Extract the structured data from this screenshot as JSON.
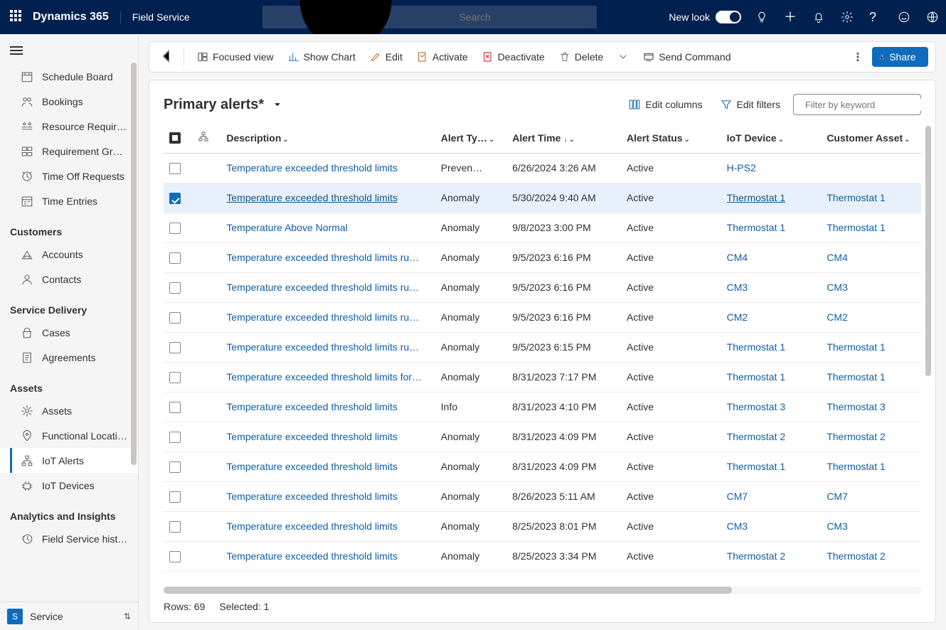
{
  "top": {
    "brand": "Dynamics 365",
    "app": "Field Service",
    "search_placeholder": "Search",
    "new_look": "New look"
  },
  "nav": {
    "groups": [
      {
        "title": null,
        "items": [
          {
            "id": "schedule-board",
            "label": "Schedule Board"
          },
          {
            "id": "bookings",
            "label": "Bookings"
          },
          {
            "id": "resource-req",
            "label": "Resource Require…"
          },
          {
            "id": "req-groups",
            "label": "Requirement Gro…"
          },
          {
            "id": "time-off",
            "label": "Time Off Requests"
          },
          {
            "id": "time-entries",
            "label": "Time Entries"
          }
        ]
      },
      {
        "title": "Customers",
        "items": [
          {
            "id": "accounts",
            "label": "Accounts"
          },
          {
            "id": "contacts",
            "label": "Contacts"
          }
        ]
      },
      {
        "title": "Service Delivery",
        "items": [
          {
            "id": "cases",
            "label": "Cases"
          },
          {
            "id": "agreements",
            "label": "Agreements"
          }
        ]
      },
      {
        "title": "Assets",
        "items": [
          {
            "id": "assets",
            "label": "Assets"
          },
          {
            "id": "func-loc",
            "label": "Functional Locati…"
          },
          {
            "id": "iot-alerts",
            "label": "IoT Alerts",
            "selected": true
          },
          {
            "id": "iot-devices",
            "label": "IoT Devices"
          }
        ]
      },
      {
        "title": "Analytics and Insights",
        "items": [
          {
            "id": "fs-history",
            "label": "Field Service histo…"
          }
        ]
      }
    ],
    "area_badge": "S",
    "area_label": "Service"
  },
  "commands": {
    "focused_view": "Focused view",
    "show_chart": "Show Chart",
    "edit": "Edit",
    "activate": "Activate",
    "deactivate": "Deactivate",
    "delete": "Delete",
    "send_command": "Send Command",
    "share": "Share"
  },
  "view": {
    "title": "Primary alerts*",
    "edit_columns": "Edit columns",
    "edit_filters": "Edit filters",
    "filter_placeholder": "Filter by keyword"
  },
  "columns": {
    "description": "Description",
    "alert_type": "Alert Ty…",
    "alert_time": "Alert Time",
    "alert_status": "Alert Status",
    "iot_device": "IoT Device",
    "customer_asset": "Customer Asset"
  },
  "rows": [
    {
      "desc": "Temperature exceeded threshold limits",
      "type": "Preven…",
      "time": "6/26/2024 3:26 AM",
      "status": "Active",
      "device": "H-PS2",
      "asset": ""
    },
    {
      "desc": "Temperature exceeded threshold limits",
      "type": "Anomaly",
      "time": "5/30/2024 9:40 AM",
      "status": "Active",
      "device": "Thermostat 1",
      "asset": "Thermostat 1",
      "selected": true
    },
    {
      "desc": "Temperature Above Normal",
      "type": "Anomaly",
      "time": "9/8/2023 3:00 PM",
      "status": "Active",
      "device": "Thermostat 1",
      "asset": "Thermostat 1"
    },
    {
      "desc": "Temperature exceeded threshold limits ru…",
      "type": "Anomaly",
      "time": "9/5/2023 6:16 PM",
      "status": "Active",
      "device": "CM4",
      "asset": "CM4"
    },
    {
      "desc": "Temperature exceeded threshold limits ru…",
      "type": "Anomaly",
      "time": "9/5/2023 6:16 PM",
      "status": "Active",
      "device": "CM3",
      "asset": "CM3"
    },
    {
      "desc": "Temperature exceeded threshold limits ru…",
      "type": "Anomaly",
      "time": "9/5/2023 6:16 PM",
      "status": "Active",
      "device": "CM2",
      "asset": "CM2"
    },
    {
      "desc": "Temperature exceeded threshold limits ru…",
      "type": "Anomaly",
      "time": "9/5/2023 6:15 PM",
      "status": "Active",
      "device": "Thermostat 1",
      "asset": "Thermostat 1"
    },
    {
      "desc": "Temperature exceeded threshold limits for…",
      "type": "Anomaly",
      "time": "8/31/2023 7:17 PM",
      "status": "Active",
      "device": "Thermostat 1",
      "asset": "Thermostat 1"
    },
    {
      "desc": "Temperature exceeded threshold limits",
      "type": "Info",
      "time": "8/31/2023 4:10 PM",
      "status": "Active",
      "device": "Thermostat 3",
      "asset": "Thermostat 3"
    },
    {
      "desc": "Temperature exceeded threshold limits",
      "type": "Anomaly",
      "time": "8/31/2023 4:09 PM",
      "status": "Active",
      "device": "Thermostat 2",
      "asset": "Thermostat 2"
    },
    {
      "desc": "Temperature exceeded threshold limits",
      "type": "Anomaly",
      "time": "8/31/2023 4:09 PM",
      "status": "Active",
      "device": "Thermostat 1",
      "asset": "Thermostat 1"
    },
    {
      "desc": "Temperature exceeded threshold limits",
      "type": "Anomaly",
      "time": "8/26/2023 5:11 AM",
      "status": "Active",
      "device": "CM7",
      "asset": "CM7"
    },
    {
      "desc": "Temperature exceeded threshold limits",
      "type": "Anomaly",
      "time": "8/25/2023 8:01 PM",
      "status": "Active",
      "device": "CM3",
      "asset": "CM3"
    },
    {
      "desc": "Temperature exceeded threshold limits",
      "type": "Anomaly",
      "time": "8/25/2023 3:34 PM",
      "status": "Active",
      "device": "Thermostat 2",
      "asset": "Thermostat 2"
    }
  ],
  "footer": {
    "rows_label": "Rows: 69",
    "selected_label": "Selected: 1"
  }
}
